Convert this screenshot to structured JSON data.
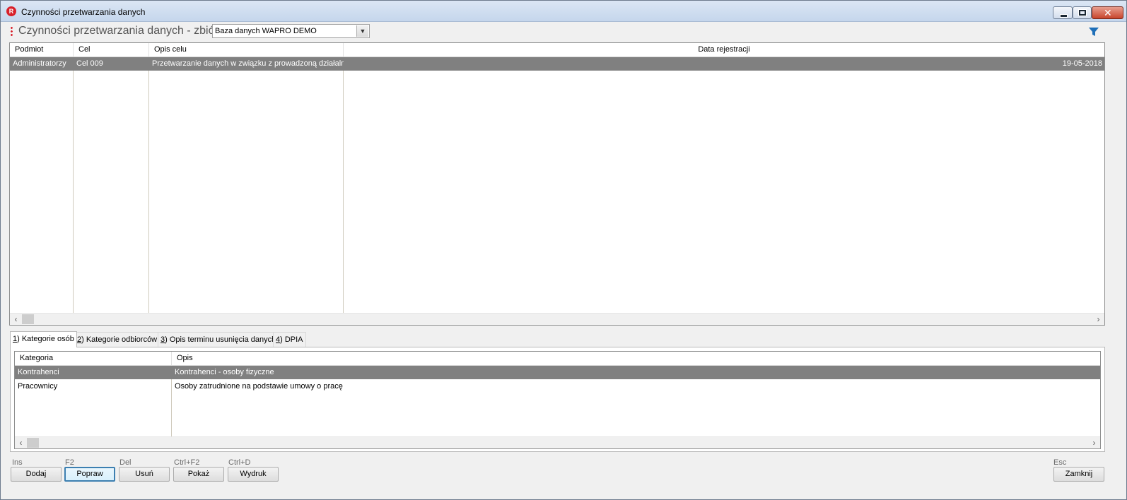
{
  "window": {
    "title": "Czynności przetwarzania danych",
    "icon": "R"
  },
  "header": {
    "title": "Czynności przetwarzania danych - zbiór",
    "database_select": "Baza danych WAPRO DEMO"
  },
  "main_grid": {
    "columns": [
      "Podmiot",
      "Cel",
      "Opis celu",
      "Data rejestracji"
    ],
    "rows": [
      {
        "podmiot": "Administratorzy",
        "cel": "Cel 009",
        "opis_celu": "Przetwarzanie danych w związku z prowadzoną działalnoś",
        "data_rejestracji": "19-05-2018"
      }
    ]
  },
  "tabs": [
    {
      "key": "1",
      "label": ") Kategorie osób"
    },
    {
      "key": "2",
      "label": ") Kategorie odbiorców"
    },
    {
      "key": "3",
      "label": ") Opis terminu usunięcia danych"
    },
    {
      "key": "4",
      "label": ") DPIA"
    }
  ],
  "sub_grid": {
    "columns": [
      "Kategoria",
      "Opis"
    ],
    "rows": [
      {
        "kategoria": "Kontrahenci",
        "opis": "Kontrahenci - osoby fizyczne"
      },
      {
        "kategoria": "Pracownicy",
        "opis": "Osoby zatrudnione na podstawie umowy o pracę"
      }
    ]
  },
  "buttons": {
    "dodaj": {
      "label": "Dodaj",
      "shortcut": "Ins"
    },
    "popraw": {
      "label": "Popraw",
      "shortcut": "F2"
    },
    "usun": {
      "label": "Usuń",
      "shortcut": "Del"
    },
    "pokaz": {
      "label": "Pokaż",
      "shortcut": "Ctrl+F2"
    },
    "wydruk": {
      "label": "Wydruk",
      "shortcut": "Ctrl+D"
    },
    "zamknij": {
      "label": "Zamknij",
      "shortcut": "Esc"
    }
  },
  "colors": {
    "selected_row": "#808080",
    "accent_red": "#d8202a",
    "filter_blue": "#1f6fb8"
  }
}
